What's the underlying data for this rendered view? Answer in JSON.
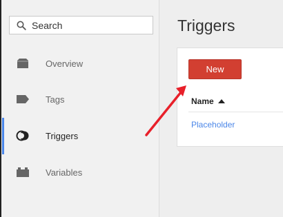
{
  "sidebar": {
    "search": {
      "placeholder": "Search"
    },
    "items": [
      {
        "label": "Overview",
        "icon": "folder-icon"
      },
      {
        "label": "Tags",
        "icon": "tag-icon"
      },
      {
        "label": "Triggers",
        "icon": "trigger-icon",
        "active": true
      },
      {
        "label": "Variables",
        "icon": "variables-icon"
      }
    ]
  },
  "main": {
    "title": "Triggers",
    "new_button": "New",
    "table": {
      "columns": [
        "Name"
      ],
      "rows": [
        {
          "name": "Placeholder"
        }
      ]
    }
  },
  "colors": {
    "accent": "#4a86e8",
    "button": "#d23f31",
    "annotation_arrow": "#e8202a"
  }
}
